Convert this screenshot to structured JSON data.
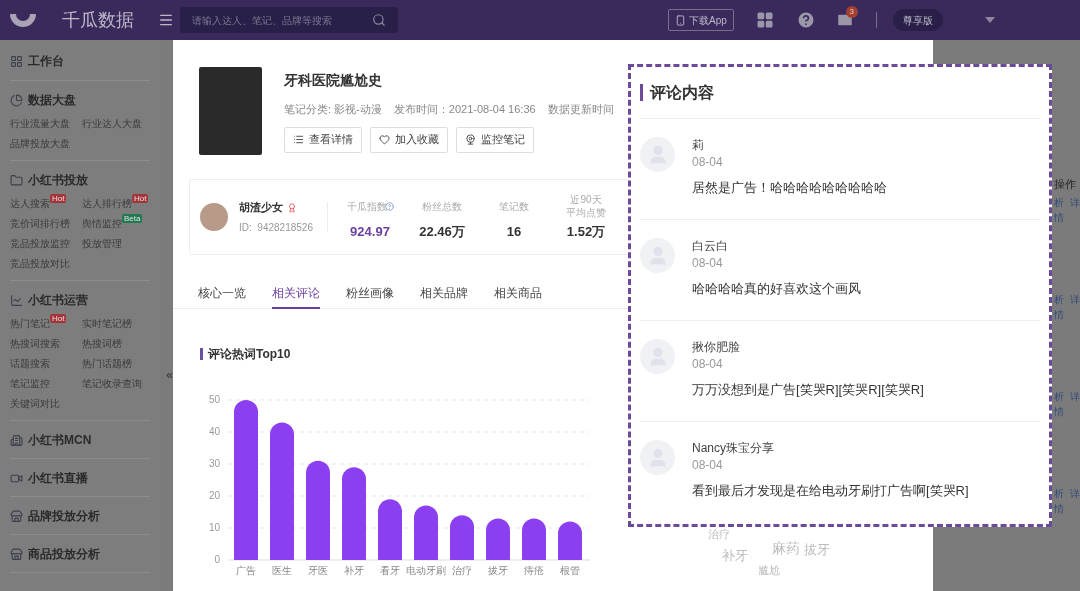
{
  "topbar": {
    "logo": "千瓜数据",
    "search": {
      "placeholder": "请输入达人、笔记、品牌等搜索"
    },
    "download": "下载App",
    "mail_count": "3",
    "plan": "尊享版"
  },
  "sidebar": {
    "sections": [
      {
        "title": "工作台"
      },
      {
        "title": "数据大盘",
        "items": [
          {
            "label": "行业流量大盘"
          },
          {
            "label": "行业达人大盘"
          },
          {
            "label": "品牌投放大盘"
          }
        ]
      },
      {
        "title": "小红书投放",
        "items": [
          {
            "label": "达人搜索",
            "badge": {
              "text": "Hot",
              "color": "#a3343a"
            }
          },
          {
            "label": "达人排行榜",
            "badge": {
              "text": "Hot",
              "color": "#a3343a"
            }
          },
          {
            "label": "竞价词排行榜"
          },
          {
            "label": "舆情监控",
            "badge": {
              "text": "Beta",
              "color": "#1e7a52"
            }
          },
          {
            "label": "竞品投放监控"
          },
          {
            "label": "投放管理"
          },
          {
            "label": "竞品投放对比"
          }
        ]
      },
      {
        "title": "小红书运营",
        "items": [
          {
            "label": "热门笔记",
            "badge": {
              "text": "Hot",
              "color": "#a3343a"
            }
          },
          {
            "label": "实时笔记榜"
          },
          {
            "label": "热搜词搜索"
          },
          {
            "label": "热搜词榜"
          },
          {
            "label": "话题搜索"
          },
          {
            "label": "热门话题榜"
          },
          {
            "label": "笔记监控"
          },
          {
            "label": "笔记收录查询"
          },
          {
            "label": "关键词对比"
          }
        ]
      },
      {
        "title": "小红书MCN"
      },
      {
        "title": "小红书直播"
      },
      {
        "title": "品牌投放分析"
      },
      {
        "title": "商品投放分析"
      }
    ],
    "collapse": "«"
  },
  "background": {
    "column_header": "操作",
    "rows": [
      {
        "a": "析",
        "b": "详",
        "c": "情"
      },
      {
        "a": "析",
        "b": "详",
        "c": "情"
      },
      {
        "a": "析",
        "b": "详",
        "c": "情"
      },
      {
        "a": "析",
        "b": "详",
        "c": "情"
      }
    ]
  },
  "note": {
    "title": "牙科医院尴尬史",
    "category": "笔记分类: 影视-动漫",
    "published": "发布时间：2021-08-04 16:36",
    "updated": "数据更新时间",
    "actions": [
      "查看详情",
      "加入收藏",
      "监控笔记"
    ]
  },
  "author": {
    "name": "胡渣少女",
    "id": "ID:  9428218526",
    "stats": [
      {
        "label": "千瓜指数",
        "value": "924.97",
        "highlight": true
      },
      {
        "label": "粉丝总数",
        "value": "22.46万",
        "highlight": false
      },
      {
        "label": "笔记数",
        "value": "16",
        "highlight": false
      },
      {
        "label": "近90天平均点赞",
        "value": "1.52万",
        "highlight": false
      }
    ]
  },
  "tabs": [
    {
      "label": "核心一览",
      "selected": false
    },
    {
      "label": "相关评论",
      "selected": true
    },
    {
      "label": "粉丝画像",
      "selected": false
    },
    {
      "label": "相关品牌",
      "selected": false
    },
    {
      "label": "相关商品",
      "selected": false
    }
  ],
  "hotwords": {
    "title": "评论热词Top10",
    "chart_data": {
      "type": "bar",
      "categories": [
        "广告",
        "医生",
        "牙医",
        "补牙",
        "看牙",
        "电动牙刷",
        "治疗",
        "拔牙",
        "痔疮",
        "根管"
      ],
      "grid": true,
      "series": [
        {
          "color": "#8b3ff0",
          "values": [
            50,
            43,
            31,
            29,
            19,
            17,
            14,
            13,
            13,
            12
          ]
        }
      ],
      "ylim": [
        0,
        50
      ],
      "yticks": [
        0,
        10,
        20,
        30,
        40,
        50
      ]
    }
  },
  "word_cloud": [
    "治疗",
    "补牙",
    "麻药",
    "拔牙",
    "尴尬"
  ],
  "comments": {
    "title": "评论内容",
    "items": [
      {
        "user": "莉",
        "date": "08-04",
        "text": "居然是广告！哈哈哈哈哈哈哈哈哈"
      },
      {
        "user": "白云白",
        "date": "08-04",
        "text": "哈哈哈哈真的好喜欢这个画风"
      },
      {
        "user": "揪你肥脸",
        "date": "08-04",
        "text": "万万没想到是广告[笑哭R][笑哭R][笑哭R]"
      },
      {
        "user": "Nancy珠宝分享",
        "date": "08-04",
        "text": "看到最后才发现是在给电动牙刷打广告啊[笑哭R]"
      }
    ]
  }
}
